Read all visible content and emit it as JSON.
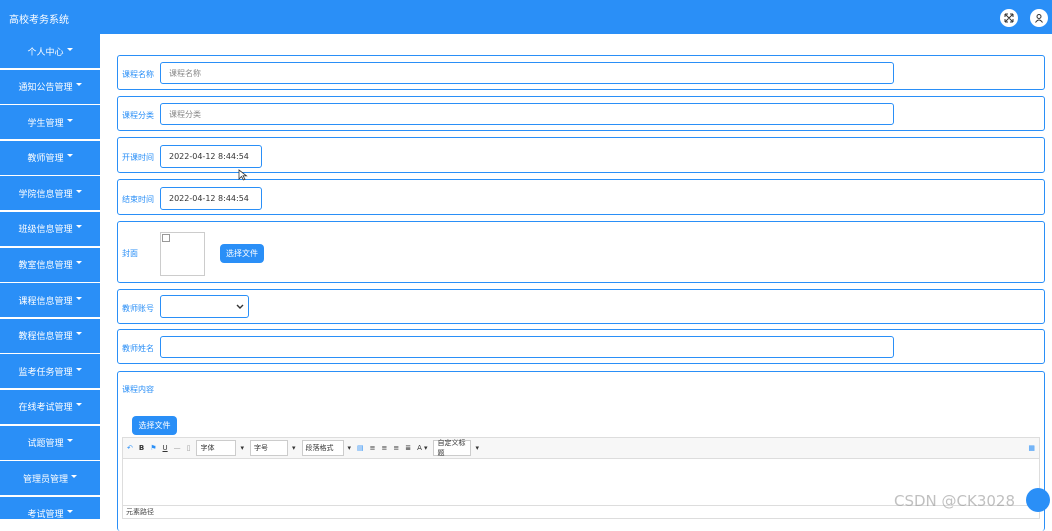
{
  "app": {
    "title": "高校考务系统",
    "accent_color": "#2a8ff7",
    "icons": [
      "fullscreen-icon",
      "user-icon"
    ]
  },
  "sidebar": {
    "items": [
      {
        "label": "个人中心"
      },
      {
        "label": "通知公告管理"
      },
      {
        "label": "学生管理"
      },
      {
        "label": "教师管理"
      },
      {
        "label": "学院信息管理"
      },
      {
        "label": "班级信息管理"
      },
      {
        "label": "教室信息管理"
      },
      {
        "label": "课程信息管理"
      },
      {
        "label": "教程信息管理"
      },
      {
        "label": "监考任务管理"
      },
      {
        "label": "在线考试管理"
      },
      {
        "label": "试题管理"
      },
      {
        "label": "管理员管理"
      },
      {
        "label": "考试管理"
      }
    ]
  },
  "form": {
    "course_name": {
      "label": "课程名称",
      "placeholder": "课程名称"
    },
    "course_category": {
      "label": "课程分类",
      "placeholder": "课程分类"
    },
    "start_time": {
      "label": "开课时间",
      "value": "2022-04-12 8:44:54"
    },
    "end_time": {
      "label": "结束时间",
      "value": "2022-04-12 8:44:54"
    },
    "cover": {
      "label": "封面",
      "button": "选择文件"
    },
    "teacher_account": {
      "label": "教师账号",
      "value": ""
    },
    "teacher_name": {
      "label": "教师姓名",
      "value": ""
    },
    "course_content": {
      "label": "课程内容",
      "upload_button": "选择文件",
      "toolbar": {
        "font": "字体",
        "font_size": "字号",
        "paragraph": "段落格式",
        "custom_title": "自定义标题"
      },
      "status_bar": "元素路径"
    }
  },
  "watermark": "CSDN @CK3028"
}
